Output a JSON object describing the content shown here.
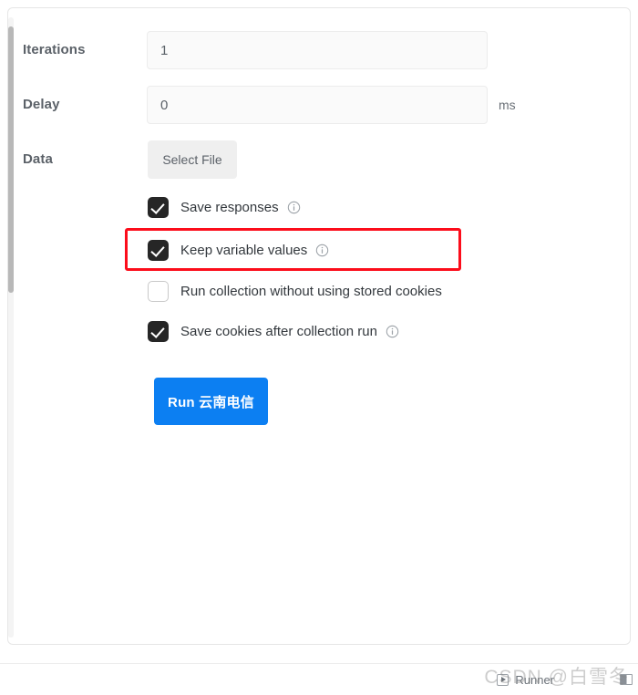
{
  "panel": {
    "name": "collection-runner-settings"
  },
  "form": {
    "iterations": {
      "label": "Iterations",
      "value": "1",
      "placeholder": ""
    },
    "delay": {
      "label": "Delay",
      "value": "0",
      "placeholder": "",
      "unit": "ms"
    },
    "data": {
      "label": "Data",
      "select_file_label": "Select File"
    }
  },
  "options": [
    {
      "id": "save-responses",
      "label": "Save responses",
      "checked": true,
      "info_icon": "info-circle-icon"
    },
    {
      "id": "keep-variables",
      "label": "Keep variable values",
      "checked": true,
      "info_icon": "info-circle-icon"
    },
    {
      "id": "no-stored-cookies",
      "label": "Run collection without using stored cookies",
      "checked": false,
      "info_icon": null
    },
    {
      "id": "save-cookies",
      "label": "Save cookies after collection run",
      "checked": true,
      "info_icon": "info-circle-icon"
    }
  ],
  "run_button": {
    "label": "Run 云南电信",
    "color": "#0c7ff2"
  },
  "highlight": {
    "target": "keep-variables",
    "color": "#fc0d1b"
  },
  "status_bar": {
    "runner_label": "Runner",
    "runner_icon": "play-square-icon",
    "right_icon": "layout-sidebar-icon"
  },
  "watermark": {
    "text": "CSDN @白雪冬"
  }
}
